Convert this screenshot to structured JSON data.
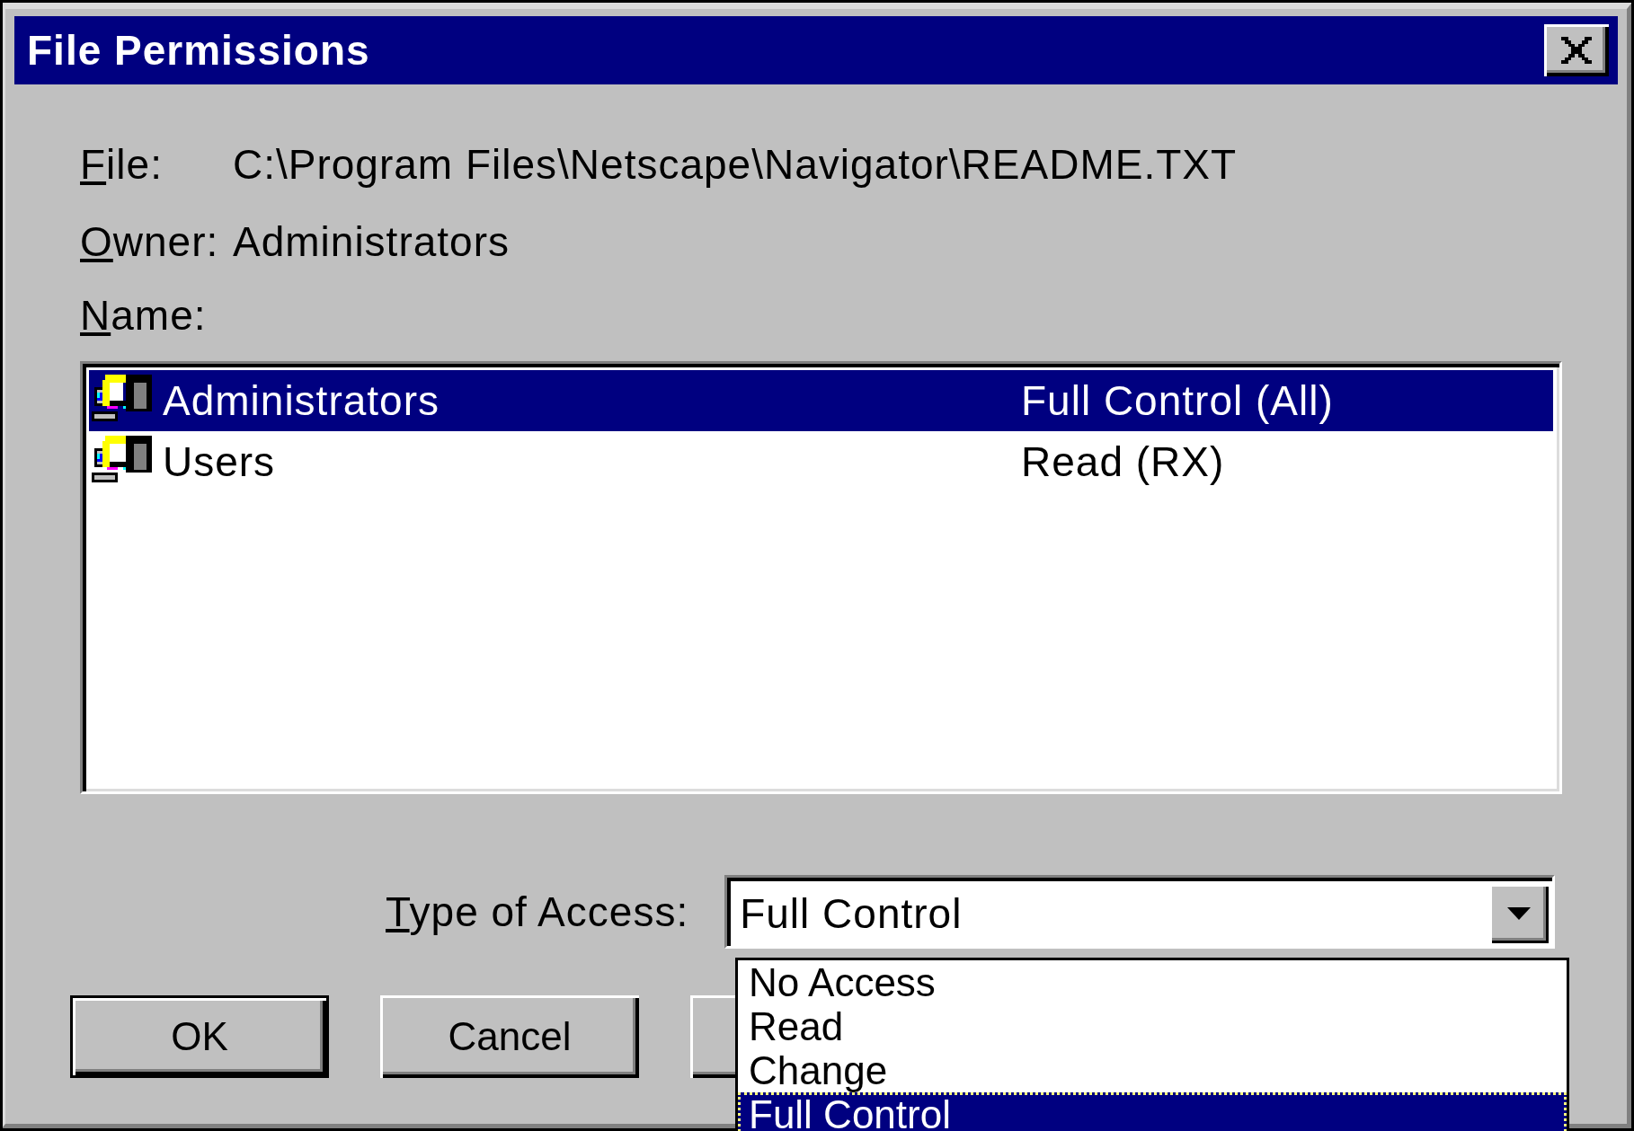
{
  "window": {
    "title": "File Permissions"
  },
  "fields": [
    {
      "label": "File:",
      "value": "C:\\Program Files\\Netscape\\Navigator\\README.TXT"
    },
    {
      "label": "Owner:",
      "value": "Administrators"
    }
  ],
  "name_label": {
    "label": "Name:"
  },
  "accounts": [
    {
      "name": "Administrators",
      "permission": "Full Control (All)",
      "selected": true
    },
    {
      "name": "Users",
      "permission": "Read (RX)",
      "selected": false
    }
  ],
  "access": {
    "label": "Type of Access:",
    "value": "Full Control",
    "expanded": true,
    "options": [
      {
        "label": "No Access",
        "selected": false
      },
      {
        "label": "Read",
        "selected": false
      },
      {
        "label": "Change",
        "selected": false
      },
      {
        "label": "Full Control",
        "selected": true
      }
    ]
  },
  "buttons": [
    {
      "label": "OK",
      "default": true
    },
    {
      "label": "Cancel",
      "default": false
    }
  ]
}
